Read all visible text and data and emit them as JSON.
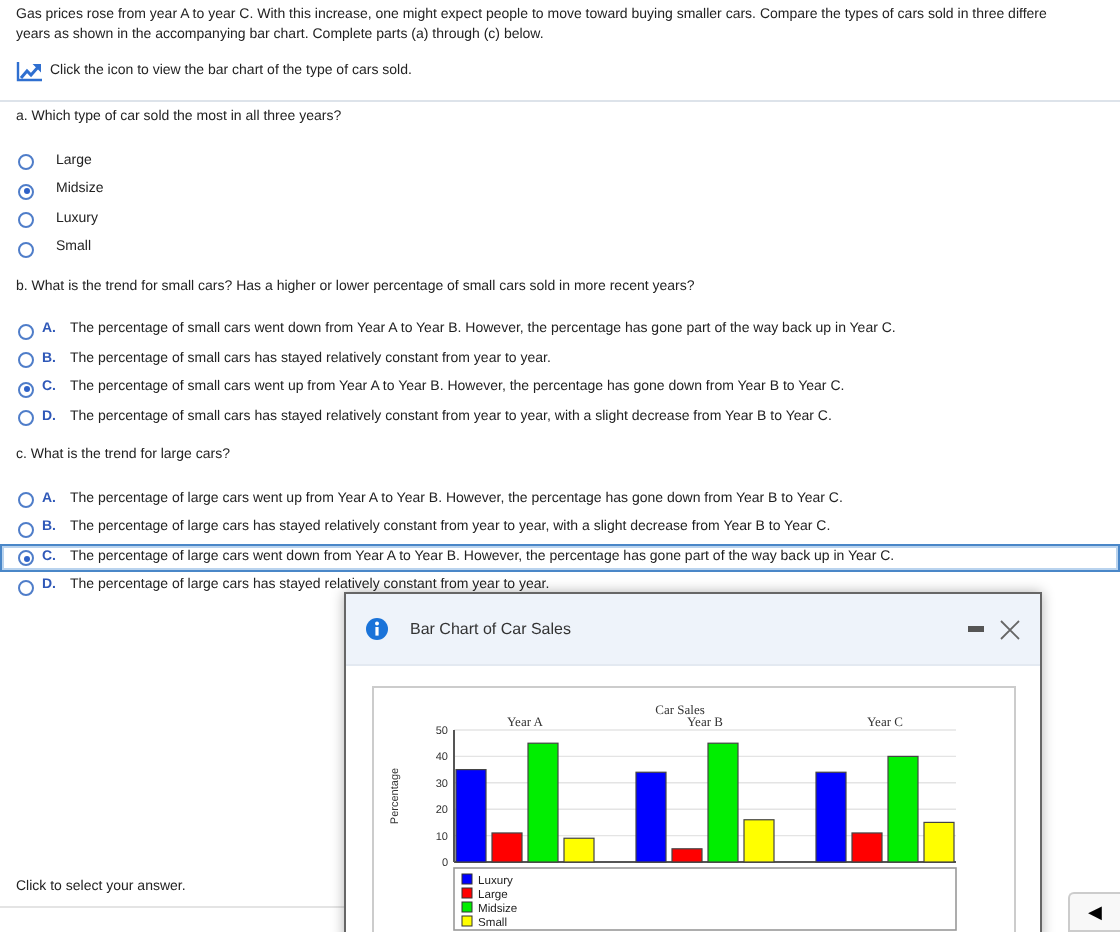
{
  "intro": [
    "Gas prices rose from year A to year C. With this increase, one might expect people to move toward buying smaller cars. Compare the types of cars sold in three differe",
    "years as shown in the accompanying bar chart. Complete parts (a) through (c) below."
  ],
  "chart_link": "Click the icon to view the bar chart of the type of cars sold.",
  "questions": [
    {
      "prompt": "a. Which type of car sold the most in all three years?",
      "kind": "plain",
      "options": [
        {
          "text": "Large",
          "selected": false,
          "focused": false
        },
        {
          "text": "Midsize",
          "selected": true,
          "focused": false
        },
        {
          "text": "Luxury",
          "selected": false,
          "focused": false
        },
        {
          "text": "Small",
          "selected": false,
          "focused": false
        }
      ]
    },
    {
      "prompt": "b. What is the trend for small cars? Has a higher or lower percentage of small cars sold in more recent years?",
      "kind": "lettered",
      "options": [
        {
          "letter": "A.",
          "text": "The percentage of small cars went down from Year A to Year B. However, the percentage has gone part of the way back up in Year C.",
          "selected": false,
          "focused": false
        },
        {
          "letter": "B.",
          "text": "The percentage of small cars has stayed relatively constant from year to year.",
          "selected": false,
          "focused": false
        },
        {
          "letter": "C.",
          "text": "The percentage of small cars went up from Year A to Year B. However, the percentage has gone down from Year B to Year C.",
          "selected": true,
          "focused": false
        },
        {
          "letter": "D.",
          "text": "The percentage of small cars has stayed relatively constant from year to year, with a slight decrease from Year B to Year C.",
          "selected": false,
          "focused": false
        }
      ]
    },
    {
      "prompt": "c. What is the trend for large cars?",
      "kind": "lettered",
      "options": [
        {
          "letter": "A.",
          "text": "The percentage of large cars went up from Year A to Year B. However, the percentage has gone down from Year B to Year C.",
          "selected": false,
          "focused": false
        },
        {
          "letter": "B.",
          "text": "The percentage of large cars has stayed relatively constant from year to year, with a slight decrease from Year B to Year C.",
          "selected": false,
          "focused": false
        },
        {
          "letter": "C.",
          "text": "The percentage of large cars went down from Year A to Year B. However, the percentage has gone part of the way back up in Year C.",
          "selected": true,
          "focused": true
        },
        {
          "letter": "D.",
          "text": "The percentage of large cars has stayed relatively constant from year to year.",
          "selected": false,
          "focused": false
        }
      ]
    }
  ],
  "status": "Click to select your answer.",
  "nav_button": "◀",
  "popup": {
    "title": "Bar Chart of Car Sales",
    "chart_data": {
      "type": "bar",
      "title": "Car Sales",
      "ylabel": "Percentage",
      "categories": [
        "Year A",
        "Year B",
        "Year C"
      ],
      "ylim": [
        0,
        50
      ],
      "grid": true,
      "legend": true,
      "yticks": [
        0,
        10,
        20,
        30,
        40,
        50
      ],
      "series": [
        {
          "name": "Luxury",
          "color": "#0000ff",
          "values": [
            35,
            34,
            34
          ]
        },
        {
          "name": "Large",
          "color": "#ff0000",
          "values": [
            11,
            5,
            11
          ]
        },
        {
          "name": "Midsize",
          "color": "#00ee00",
          "values": [
            45,
            45,
            40
          ]
        },
        {
          "name": "Small",
          "color": "#ffff00",
          "values": [
            9,
            16,
            15
          ]
        }
      ]
    }
  }
}
